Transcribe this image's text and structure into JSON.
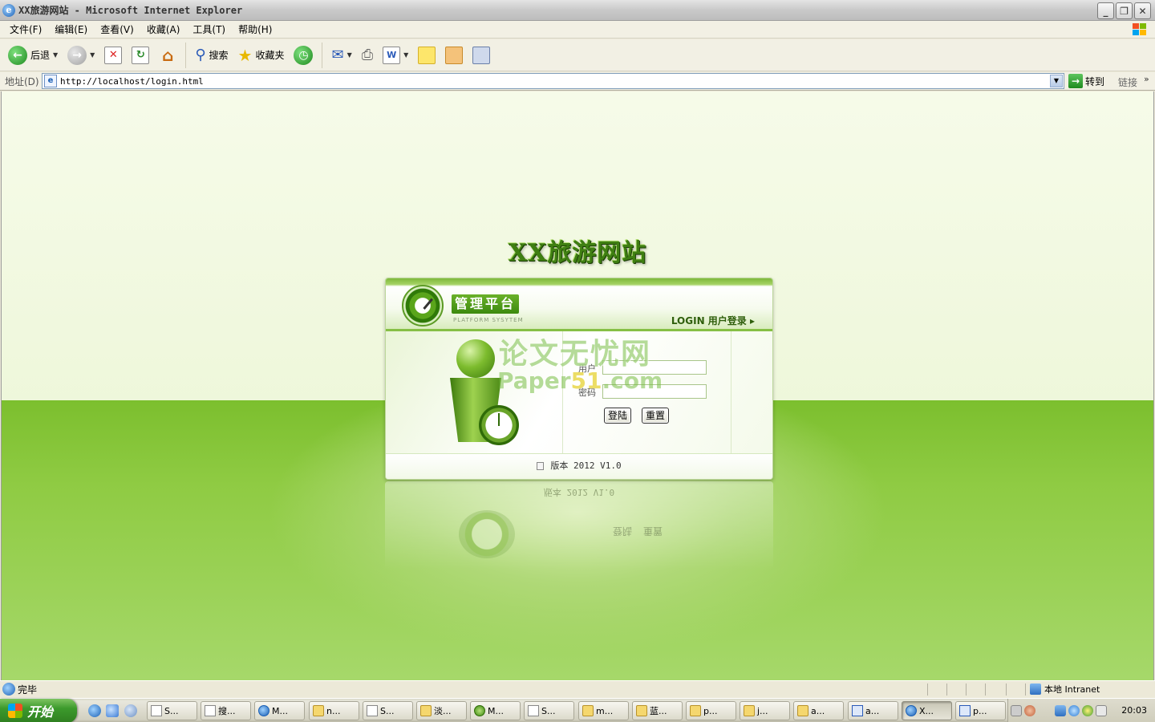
{
  "window": {
    "title": "XX旅游网站 - Microsoft Internet Explorer",
    "buttons": {
      "minimize": "_",
      "maximize": "❐",
      "close": "✕"
    }
  },
  "menubar": {
    "items": [
      "文件(F)",
      "编辑(E)",
      "查看(V)",
      "收藏(A)",
      "工具(T)",
      "帮助(H)"
    ]
  },
  "toolbar": {
    "back_label": "后退",
    "search_label": "搜索",
    "favorites_label": "收藏夹"
  },
  "addressbar": {
    "label": "地址(D)",
    "url": "http://localhost/login.html",
    "go_label": "转到",
    "links_label": "链接",
    "more": "»"
  },
  "page": {
    "site_title": "XX旅游网站",
    "panel": {
      "badge": "管理平台",
      "subtitle": "PLATFORM SYSYTEM",
      "login_link": "LOGIN 用户登录 ▸",
      "user_label": "用户",
      "password_label": "密码",
      "login_button": "登陆",
      "reset_button": "重置",
      "footer": "版本 2012 V1.0"
    },
    "watermark": {
      "line1": "论文无忧网",
      "line2_a": "Paper",
      "line2_b": "51",
      "line2_c": ".com"
    }
  },
  "statusbar": {
    "status": "完毕",
    "zone": "本地 Intranet"
  },
  "taskbar": {
    "start_label": "开始",
    "tasks": [
      {
        "label": "S...",
        "icon": "app"
      },
      {
        "label": "搜...",
        "icon": "app"
      },
      {
        "label": "M...",
        "icon": "ie"
      },
      {
        "label": "n...",
        "icon": "folder"
      },
      {
        "label": "S...",
        "icon": "app"
      },
      {
        "label": "淡...",
        "icon": "folder"
      },
      {
        "label": "M...",
        "icon": "green"
      },
      {
        "label": "S...",
        "icon": "app"
      },
      {
        "label": "m...",
        "icon": "folder"
      },
      {
        "label": "蓝...",
        "icon": "folder"
      },
      {
        "label": "p...",
        "icon": "folder"
      },
      {
        "label": "j...",
        "icon": "folder"
      },
      {
        "label": "a...",
        "icon": "folder"
      },
      {
        "label": "a...",
        "icon": "word"
      },
      {
        "label": "X...",
        "icon": "ie",
        "active": true
      },
      {
        "label": "p...",
        "icon": "word"
      }
    ],
    "clock": "20:03"
  }
}
